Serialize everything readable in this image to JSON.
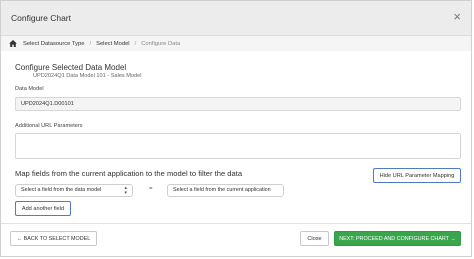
{
  "dialog": {
    "title": "Configure Chart",
    "close_glyph": "×"
  },
  "breadcrumb": {
    "icon": "home-icon",
    "separator": "/",
    "items": [
      "Select Datasource Type",
      "Select Model",
      "Configure Data"
    ]
  },
  "model": {
    "section_title": "Configure Selected Data Model",
    "subtitle": "UPD2024Q1 Data Model 101 - Sales Model"
  },
  "fields": {
    "data_model_label": "Data Model",
    "data_model_value": "UPD2024Q1.D00101",
    "url_params_label": "Additional URL Parameters",
    "url_params_value": ""
  },
  "mapping": {
    "title": "Map fields from the current application to the model to filter the data",
    "hide_button": "Hide URL Parameter Mapping",
    "left_select": "Select a field from the data model",
    "equals": "=",
    "right_select": "Select a field from the current application",
    "add_button": "Add another field"
  },
  "footer": {
    "back_button": "← BACK TO SELECT MODEL",
    "close_button": "Close",
    "next_button": "NEXT: PROCEED AND CONFIGURE CHART →"
  },
  "colors": {
    "primary_green": "#3aa64c",
    "accent_blue": "#4f7cc5",
    "titlebar": "#ececec"
  }
}
